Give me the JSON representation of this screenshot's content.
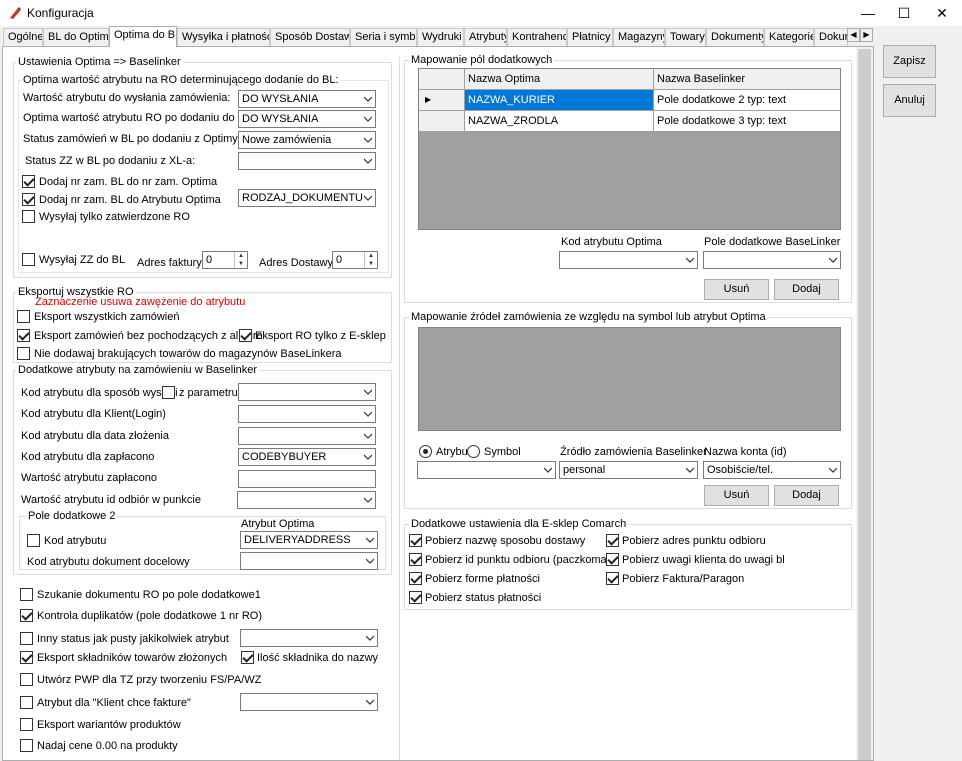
{
  "window": {
    "title": "Konfiguracja",
    "minimize_glyph": "—",
    "maximize_glyph": "☐",
    "close_glyph": "✕"
  },
  "tabs": [
    "Ogólne",
    "BL do Optima",
    "Optima do BL",
    "Wysyłka i płatności",
    "Sposób Dostawy",
    "Seria i symbol",
    "Wydruki",
    "Atrybuty",
    "Kontrahenci",
    "Płatnicy",
    "Magazyny",
    "Towary",
    "Dokumenty",
    "Kategorie",
    "Dokum"
  ],
  "active_tab": "Optima do BL",
  "side": {
    "save": "Zapisz",
    "cancel": "Anuluj"
  },
  "ustawienia": {
    "title": "Ustawienia Optima => Baselinker",
    "sub_title": "Optima wartość atrybutu na RO determinującego dodanie do BL:",
    "r1_label": "Wartość atrybutu do wysłania zamówienia:",
    "r1_value": "DO WYSŁANIA",
    "r2_label": "Optima wartość atrybutu RO po dodaniu do BL:",
    "r2_value": "DO WYSŁANIA",
    "r3_label": "Status zamówień w BL po dodaniu z Optimy:",
    "r3_value": "Nowe zamówienia",
    "r4_label": "Status ZZ w BL po dodaniu z XL-a:",
    "r4_value": "",
    "cb1": "Dodaj nr zam. BL do nr zam. Optima",
    "cb2": "Dodaj nr zam. BL do Atrybutu Optima",
    "cb2_value": "RODZAJ_DOKUMENTU",
    "cb3": "Wysyłaj tylko zatwierdzone RO",
    "cb4": "Wysyłaj ZZ do BL",
    "adres_faktury": "Adres faktury:",
    "adres_faktury_value": "0",
    "adres_dostawy": "Adres Dostawy:",
    "adres_dostawy_value": "0"
  },
  "eksport": {
    "title": "Eksportuj wszystkie RO",
    "warning": "Zaznaczenie usuwa zawężenie do atrybutu",
    "cb1": "Eksport wszystkich zamówień",
    "cb2": "Eksport zamówień bez pochodzących z allegro",
    "cb3": "Eksport RO tylko z E-sklep",
    "cb4": "Nie dodawaj brakujących towarów do magazynów BaseLinkera"
  },
  "dodatkowe": {
    "title": "Dodatkowe atrybuty na zamówieniu w Baselinker",
    "r1": "Kod atrybutu dla sposób wysyłki",
    "r1_cb": "z parametru",
    "r1_value": "",
    "r2": "Kod atrybutu dla Klient(Login)",
    "r2_value": "",
    "r3": "Kod atrybutu dla data złożenia",
    "r3_value": "",
    "r4": "Kod atrybutu dla zapłacono",
    "r4_value": "CODEBYBUYER",
    "r5": "Wartość atrybutu zapłacono",
    "r5_value": "",
    "r6": "Wartość atrybutu id odbiór w punkcie",
    "r6_value": "",
    "pole_title": "Pole dodatkowe 2",
    "atrybut_optima": "Atrybut Optima",
    "kod_atrybutu": "Kod atrybutu",
    "kod_value": "DELIVERYADDRESS",
    "dok_docelowy": "Kod atrybutu dokument docelowy",
    "dok_value": ""
  },
  "bottom": {
    "cb1": "Szukanie dokumentu RO po pole dodatkowe1",
    "cb2": "Kontrola duplikatów (pole dodatkowe 1 nr RO)",
    "cb3": "Inny status jak pusty jakikolwiek atrybut",
    "cb3_value": "",
    "cb4": "Eksport składników towarów złożonych",
    "cb4b": "Ilość składnika do nazwy",
    "cb5": "Utwórz PWP dla TZ przy tworzeniu FS/PA/WZ",
    "cb6": "Atrybut dla \"Klient chce fakture\"",
    "cb6_value": "",
    "cb7": "Eksport wariantów produktów",
    "cb8": "Nadaj cene 0.00 na produkty"
  },
  "mapowanie_pol": {
    "title": "Mapowanie pól dodatkowych",
    "col1": "Nazwa Optima",
    "col2": "Nazwa Baselinker",
    "row_marker": "▶",
    "rows": [
      {
        "optima": "NAZWA_KURIER",
        "baselinker": "Pole dodatkowe 2 typ: text"
      },
      {
        "optima": "NAZWA_ZRODLA",
        "baselinker": "Pole dodatkowe 3 typ: text"
      }
    ],
    "kod_label": "Kod atrybutu Optima",
    "kod_value": "",
    "pole_label": "Pole dodatkowe BaseLinker",
    "pole_value": "",
    "remove": "Usuń",
    "add": "Dodaj"
  },
  "mapowanie_zrodel": {
    "title": "Mapowanie źródeł zamówienia ze względu na symbol lub atrybut Optima",
    "radio1": "Atrybut",
    "radio2": "Symbol",
    "combo1_value": "",
    "zrodlo_label": "Źródło zamówienia Baselinker",
    "zrodlo_value": "personal",
    "konto_label": "Nazwa konta (id)",
    "konto_value": "Osobiście/tel.",
    "remove": "Usuń",
    "add": "Dodaj"
  },
  "esklep": {
    "title": "Dodatkowe ustawienia dla E-sklep Comarch",
    "l1": "Pobierz nazwę sposobu dostawy",
    "l2": "Pobierz id punktu odbioru (paczkomat)",
    "l3": "Pobierz forme płatności",
    "l4": "Pobierz status płatności",
    "r1": "Pobierz adres punktu odbioru",
    "r2": "Pobierz uwagi klienta do uwagi bl",
    "r3": "Pobierz Faktura/Paragon"
  }
}
